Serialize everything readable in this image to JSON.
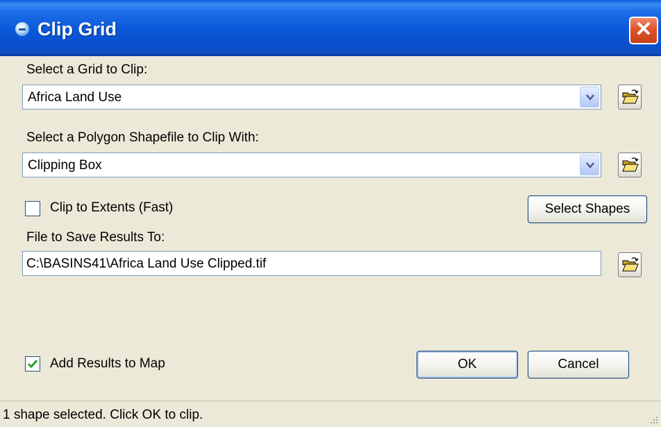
{
  "window": {
    "title": "Clip Grid",
    "icon": "globe-icon",
    "close_glyph": "✕"
  },
  "grid": {
    "label": "Select a Grid to Clip:",
    "value": "Africa Land Use"
  },
  "polygon": {
    "label": "Select a Polygon Shapefile to Clip With:",
    "value": "Clipping Box"
  },
  "clip_extents": {
    "label": "Clip to Extents (Fast)",
    "checked": false
  },
  "select_shapes": {
    "label": "Select Shapes"
  },
  "save": {
    "label": "File to Save Results To:",
    "value": "C:\\BASINS41\\Africa Land Use Clipped.tif"
  },
  "add_results": {
    "label": "Add Results to Map",
    "checked": true
  },
  "buttons": {
    "ok": "OK",
    "cancel": "Cancel"
  },
  "status": {
    "text": "1 shape selected. Click OK to clip."
  },
  "colors": {
    "titlebar": "#0a58d8",
    "face": "#ece9d8",
    "close": "#e0542a",
    "check": "#21a121"
  }
}
